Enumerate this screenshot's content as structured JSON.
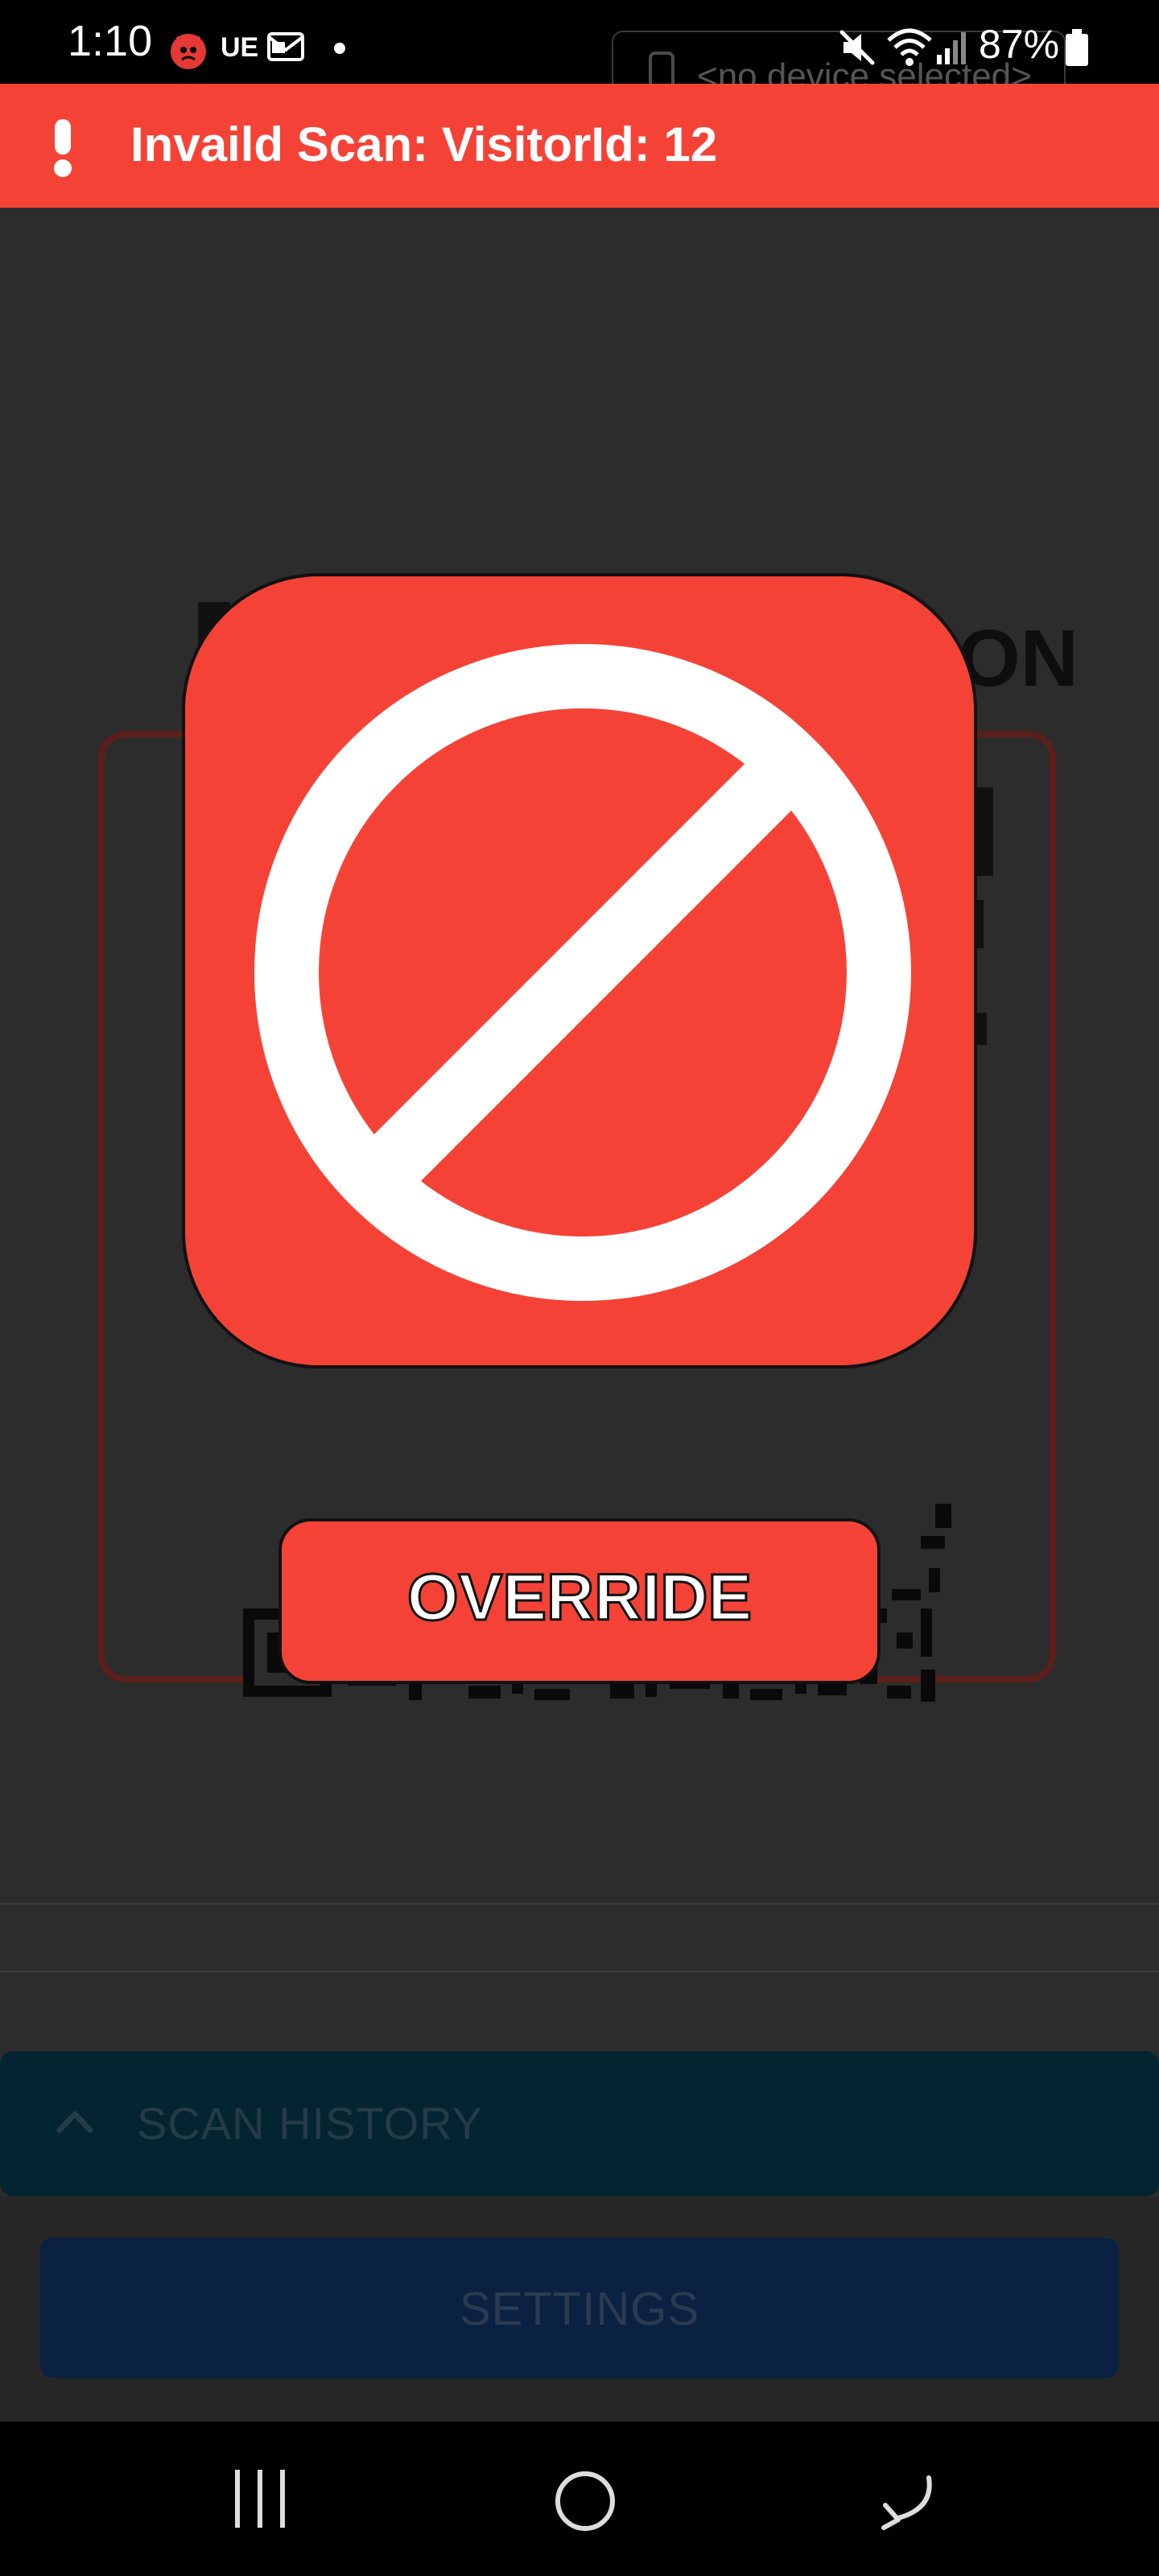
{
  "status_bar": {
    "time": "1:10",
    "carrier_badge": "UE",
    "battery_percent": "87%",
    "icons": [
      "alert-app-icon",
      "ue-icon",
      "message-icon",
      "dot-icon",
      "mute-icon",
      "wifi-icon",
      "signal-icon",
      "battery-icon"
    ]
  },
  "banner": {
    "icon": "exclamation-icon",
    "message": "Invaild Scan: VisitorId: 12",
    "color": "#f44336"
  },
  "background": {
    "device_selector": "<no device selected>",
    "title_fragment": "ON"
  },
  "modal": {
    "icon": "no-entry-icon",
    "tile_color": "#f44336",
    "override_label": "OVERRIDE"
  },
  "scan_history": {
    "label": "SCAN HISTORY",
    "icon": "chevron-up-icon"
  },
  "settings": {
    "label": "SETTINGS"
  },
  "nav_bar": {
    "icons": [
      "recents-icon",
      "home-icon",
      "back-icon"
    ]
  }
}
